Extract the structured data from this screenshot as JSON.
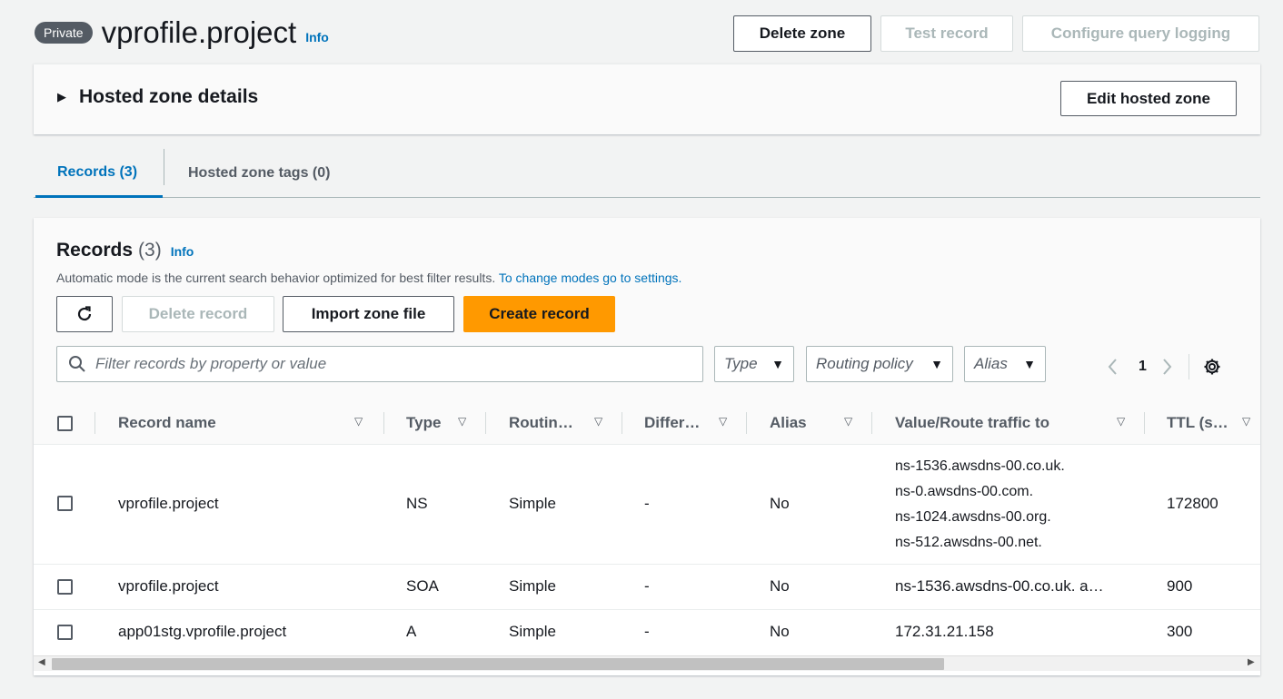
{
  "header": {
    "badge": "Private",
    "title": "vprofile.project",
    "info": "Info",
    "delete_zone": "Delete zone",
    "test_record": "Test record",
    "configure_logging": "Configure query logging"
  },
  "details": {
    "title": "Hosted zone details",
    "edit": "Edit hosted zone"
  },
  "tabs": {
    "records": "Records (3)",
    "tags": "Hosted zone tags (0)"
  },
  "records": {
    "title": "Records",
    "count": "(3)",
    "info": "Info",
    "description": "Automatic mode is the current search behavior optimized for best filter results. ",
    "description_link": "To change modes go to settings.",
    "delete_record": "Delete record",
    "import_zone": "Import zone file",
    "create_record": "Create record",
    "filter_placeholder": "Filter records by property or value",
    "type_select": "Type",
    "routing_select": "Routing policy",
    "alias_select": "Alias",
    "page": "1"
  },
  "columns": [
    "Record name",
    "Type",
    "Routin…",
    "Differ…",
    "Alias",
    "Value/Route traffic to",
    "TTL (s…"
  ],
  "rows": [
    {
      "name": "vprofile.project",
      "type": "NS",
      "routing": "Simple",
      "diff": "-",
      "alias": "No",
      "values": [
        "ns-1536.awsdns-00.co.uk.",
        "ns-0.awsdns-00.com.",
        "ns-1024.awsdns-00.org.",
        "ns-512.awsdns-00.net."
      ],
      "ttl": "172800"
    },
    {
      "name": "vprofile.project",
      "type": "SOA",
      "routing": "Simple",
      "diff": "-",
      "alias": "No",
      "values": [
        "ns-1536.awsdns-00.co.uk. a…"
      ],
      "ttl": "900"
    },
    {
      "name": "app01stg.vprofile.project",
      "type": "A",
      "routing": "Simple",
      "diff": "-",
      "alias": "No",
      "values": [
        "172.31.21.158"
      ],
      "ttl": "300"
    }
  ],
  "colors": {
    "accent": "#0073bb",
    "primary": "#ff9900",
    "text": "#16191f",
    "muted": "#545b64"
  }
}
